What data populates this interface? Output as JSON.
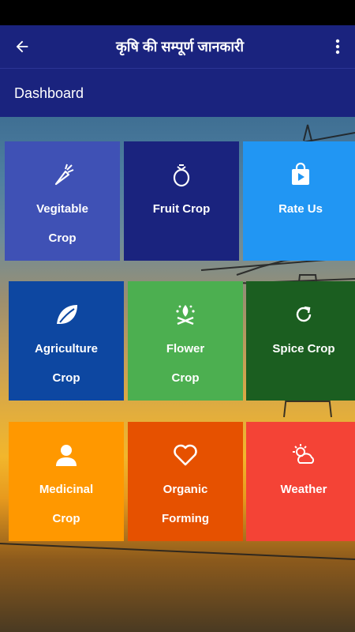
{
  "appbar": {
    "title": "कृषि की सम्पूर्ण जानकारी"
  },
  "dashboard": {
    "label": "Dashboard"
  },
  "tiles": [
    {
      "line1": "Vegitable",
      "line2": "Crop",
      "color": "#3f51b5",
      "icon": "carrot-icon"
    },
    {
      "line1": "Fruit Crop",
      "line2": "",
      "color": "#1a237e",
      "icon": "fruit-icon"
    },
    {
      "line1": "Rate Us",
      "line2": "",
      "color": "#2196f3",
      "icon": "play-store-icon"
    },
    {
      "line1": "Agriculture",
      "line2": "Crop",
      "color": "#0d47a1",
      "icon": "leaf-icon"
    },
    {
      "line1": "Flower",
      "line2": "Crop",
      "color": "#4caf50",
      "icon": "flower-icon"
    },
    {
      "line1": "Spice Crop",
      "line2": "",
      "color": "#1b5e20",
      "icon": "refresh-icon"
    },
    {
      "line1": "Medicinal",
      "line2": "Crop",
      "color": "#ff9800",
      "icon": "person-icon"
    },
    {
      "line1": "Organic",
      "line2": "Forming",
      "color": "#e65100",
      "icon": "heart-icon"
    },
    {
      "line1": "Weather",
      "line2": "",
      "color": "#f44336",
      "icon": "weather-icon"
    }
  ]
}
